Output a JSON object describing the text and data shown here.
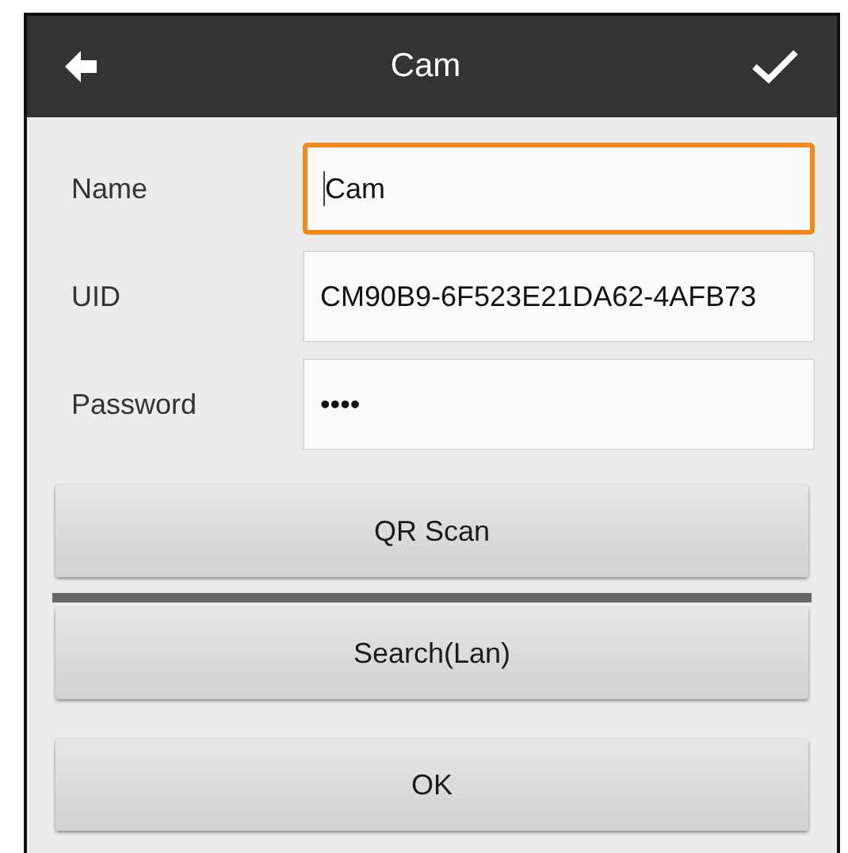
{
  "header": {
    "title": "Cam"
  },
  "fields": [
    {
      "label": "Name",
      "value": "Cam",
      "focused": true
    },
    {
      "label": "UID",
      "value": "CM90B9-6F523E21DA62-4AFB73",
      "focused": false
    },
    {
      "label": "Password",
      "value": "••••",
      "focused": false
    }
  ],
  "buttons": [
    {
      "label": "QR Scan",
      "kind": "divided"
    },
    {
      "label": "Search(Lan)",
      "kind": "plain"
    },
    {
      "label": "OK",
      "kind": "separate"
    }
  ]
}
